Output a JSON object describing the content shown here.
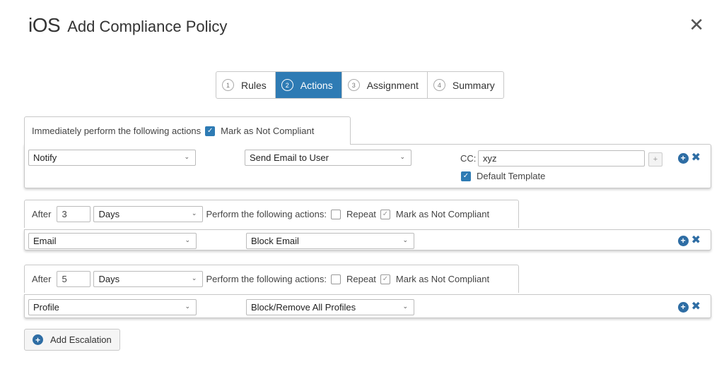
{
  "header": {
    "os_label": "iOS",
    "title": "Add Compliance Policy",
    "close_glyph": "✕"
  },
  "steps": [
    {
      "num": "1",
      "label": "Rules",
      "active": false
    },
    {
      "num": "2",
      "label": "Actions",
      "active": true
    },
    {
      "num": "3",
      "label": "Assignment",
      "active": false
    },
    {
      "num": "4",
      "label": "Summary",
      "active": false
    }
  ],
  "immediate": {
    "prefix": "Immediately perform the following actions",
    "mark_not_compliant_label": "Mark as Not Compliant",
    "mark_not_compliant_checked": true,
    "action": "Notify",
    "sub_action": "Send Email to User",
    "cc_label": "CC:",
    "cc_value": "xyz",
    "cc_add_glyph": "+",
    "default_template_label": "Default Template",
    "default_template_checked": true
  },
  "escalations": [
    {
      "after_label": "After",
      "days_value": "3",
      "unit": "Days",
      "perform_label": "Perform the following actions:",
      "repeat_label": "Repeat",
      "repeat_checked": false,
      "mark_label": "Mark as Not Compliant",
      "mark_checked": true,
      "action": "Email",
      "sub_action": "Block Email"
    },
    {
      "after_label": "After",
      "days_value": "5",
      "unit": "Days",
      "perform_label": "Perform the following actions:",
      "repeat_label": "Repeat",
      "repeat_checked": false,
      "mark_label": "Mark as Not Compliant",
      "mark_checked": true,
      "action": "Profile",
      "sub_action": "Block/Remove All Profiles"
    }
  ],
  "add_escalation_label": "Add Escalation",
  "glyphs": {
    "chevron": "⌄",
    "check": "✓",
    "plus": "+",
    "remove": "✖"
  },
  "colors": {
    "accent": "#2e7bb4",
    "icon_blue": "#2e6da4",
    "border": "#c8c8c8"
  }
}
